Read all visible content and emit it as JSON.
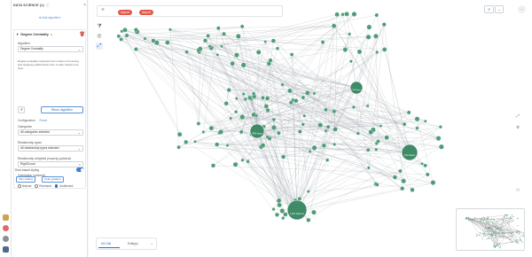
{
  "panel": {
    "title": "DATA SCIENCE (1)",
    "add_algorithm": "Add algorithm",
    "algorithm_name": "Degree Centrality",
    "algorithm_label": "Algorithm",
    "algorithm_value": "Degree Centrality",
    "description": "Degree centrality measures the number of incoming and outgoing relationships from a node. Read more here.",
    "rerun_label": "Rerun algorithm",
    "configuration_label": "Configuration",
    "reset_label": "Reset",
    "categories_label": "Categories",
    "categories_value": "All categories selected",
    "relationship_types_label": "Relationship types",
    "relationship_types_value": "All relationship types selected",
    "weighted_label": "Relationship weighted property (optional)",
    "weighted_value": "RightCount",
    "orientation_label": "Orientation (optional)",
    "orientation_options": [
      "Natural",
      "Reversed",
      "Undirected"
    ],
    "orientation_selected": "Undirected",
    "styling_label": "Rule-based styling",
    "styling_on": true,
    "size_scaling": "Size scaling",
    "color_gradient": "Color gradient"
  },
  "search": {
    "pills": [
      "Airport",
      "Airport"
    ]
  },
  "bottom_tabs": [
    "All CAB",
    "Entity(s)"
  ],
  "big_nodes": [
    {
      "label": "LAX Airport"
    },
    {
      "label": "ORD Airport"
    },
    {
      "label": "DFW Airport"
    },
    {
      "label": "ATL Airport"
    }
  ],
  "colors": {
    "node": "#4e9c78",
    "node_big": "#3f8a67",
    "edge": "#9aa1a8",
    "pill": "#e1574a",
    "accent": "#2d6cc0"
  },
  "icons": [
    "close-icon",
    "filter-icon",
    "layers-icon",
    "select-icon",
    "gear-icon",
    "share-icon",
    "zoom-in-icon",
    "zoom-out-icon"
  ]
}
